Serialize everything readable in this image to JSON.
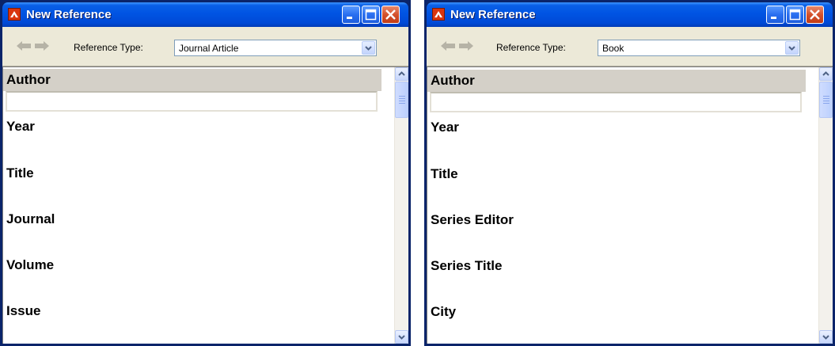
{
  "windows": [
    {
      "title": "New Reference",
      "reference_type_label": "Reference Type:",
      "reference_type_value": "Journal Article",
      "first_field": "Author",
      "fields": [
        "Year",
        "Title",
        "Journal",
        "Volume",
        "Issue"
      ]
    },
    {
      "title": "New Reference",
      "reference_type_label": "Reference Type:",
      "reference_type_value": "Book",
      "first_field": "Author",
      "fields": [
        "Year",
        "Title",
        "Series Editor",
        "Series Title",
        "City"
      ]
    }
  ],
  "icons": {
    "app": "endnote-app-icon",
    "minimize": "minimize-icon",
    "maximize": "maximize-icon",
    "close": "close-icon",
    "back": "back-arrow-icon",
    "forward": "forward-arrow-icon",
    "dropdown": "chevron-down-icon",
    "scroll_up": "scroll-up-icon",
    "scroll_down": "scroll-down-icon"
  },
  "colors": {
    "titlebar": "#0054e3",
    "close_button": "#d4512c",
    "toolbar": "#ece9d8",
    "field_header": "#d4d0c8"
  }
}
